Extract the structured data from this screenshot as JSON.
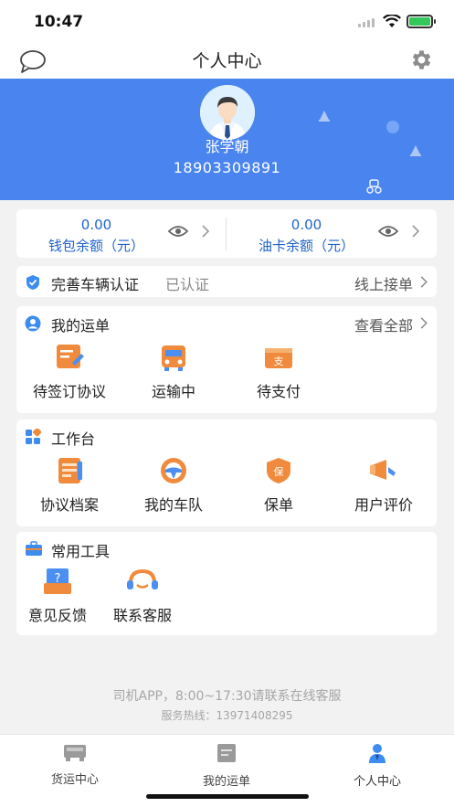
{
  "status_bar": {
    "time": "10:47"
  },
  "nav": {
    "title": "个人中心",
    "left_icon": "chat-bubble-icon",
    "right_icon": "gear-icon"
  },
  "profile": {
    "name": "张学朝",
    "phone": "18903309891"
  },
  "balances": [
    {
      "value": "0.00",
      "label": "钱包余额（元）"
    },
    {
      "value": "0.00",
      "label": "油卡余额（元）"
    }
  ],
  "verify": {
    "title": "完善车辆认证",
    "status": "已认证",
    "action": "线上接单"
  },
  "orders": {
    "title": "我的运单",
    "more": "查看全部",
    "items": [
      {
        "label": "待签订协议",
        "icon": "contract-icon"
      },
      {
        "label": "运输中",
        "icon": "truck-icon"
      },
      {
        "label": "待支付",
        "icon": "pay-icon"
      }
    ]
  },
  "workbench": {
    "title": "工作台",
    "items": [
      {
        "label": "协议档案",
        "icon": "archive-icon"
      },
      {
        "label": "我的车队",
        "icon": "steering-wheel-icon"
      },
      {
        "label": "保单",
        "icon": "insurance-icon"
      },
      {
        "label": "用户评价",
        "icon": "megaphone-icon"
      }
    ]
  },
  "tools": {
    "title": "常用工具",
    "items": [
      {
        "label": "意见反馈",
        "icon": "feedback-icon"
      },
      {
        "label": "联系客服",
        "icon": "headset-icon"
      }
    ]
  },
  "footer": {
    "line1": "司机APP，8:00~17:30请联系在线客服",
    "line2": "服务热线：13971408295"
  },
  "tabs": [
    {
      "label": "货运中心",
      "icon": "cargo-truck-icon",
      "active": false
    },
    {
      "label": "我的运单",
      "icon": "waybill-icon",
      "active": false
    },
    {
      "label": "个人中心",
      "icon": "person-icon",
      "active": true
    }
  ],
  "colors": {
    "brand_blue": "#4a84ee",
    "balance_text": "#1f63c8",
    "page_bg": "#f2f2f2"
  }
}
